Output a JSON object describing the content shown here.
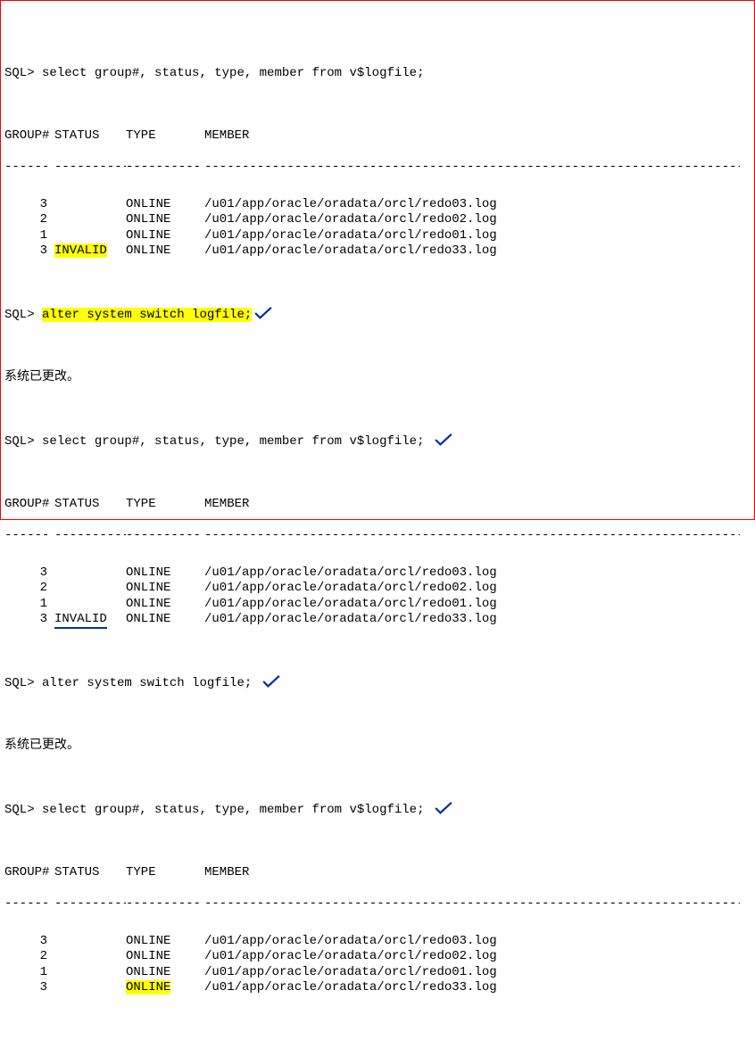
{
  "prompt": "SQL>",
  "cmd_select": "select group#, status, type, member from v$logfile;",
  "cmd_alter": "alter system switch logfile;",
  "msg_changed": "系统已更改。",
  "headers": {
    "group": "GROUP#",
    "status": "STATUS",
    "type": "TYPE",
    "member": "MEMBER"
  },
  "dashes": {
    "group": "------",
    "status": "----------",
    "type": "----------",
    "member": "--------------------------------------------------------------------------------"
  },
  "block1": {
    "rows": [
      {
        "group": "3",
        "status": "",
        "type": "ONLINE",
        "member": "/u01/app/oracle/oradata/orcl/redo03.log"
      },
      {
        "group": "2",
        "status": "",
        "type": "ONLINE",
        "member": "/u01/app/oracle/oradata/orcl/redo02.log"
      },
      {
        "group": "1",
        "status": "",
        "type": "ONLINE",
        "member": "/u01/app/oracle/oradata/orcl/redo01.log"
      },
      {
        "group": "3",
        "status": "INVALID",
        "type": "ONLINE",
        "member": "/u01/app/oracle/oradata/orcl/redo33.log",
        "status_hl": true
      }
    ]
  },
  "block2": {
    "rows": [
      {
        "group": "3",
        "status": "",
        "type": "ONLINE",
        "member": "/u01/app/oracle/oradata/orcl/redo03.log"
      },
      {
        "group": "2",
        "status": "",
        "type": "ONLINE",
        "member": "/u01/app/oracle/oradata/orcl/redo02.log"
      },
      {
        "group": "1",
        "status": "",
        "type": "ONLINE",
        "member": "/u01/app/oracle/oradata/orcl/redo01.log"
      },
      {
        "group": "3",
        "status": "INVALID",
        "type": "ONLINE",
        "member": "/u01/app/oracle/oradata/orcl/redo33.log",
        "status_ul": true
      }
    ]
  },
  "block3": {
    "rows": [
      {
        "group": "3",
        "status": "",
        "type": "ONLINE",
        "member": "/u01/app/oracle/oradata/orcl/redo03.log"
      },
      {
        "group": "2",
        "status": "",
        "type": "ONLINE",
        "member": "/u01/app/oracle/oradata/orcl/redo02.log"
      },
      {
        "group": "1",
        "status": "",
        "type": "ONLINE",
        "member": "/u01/app/oracle/oradata/orcl/redo01.log"
      },
      {
        "group": "3",
        "status": "",
        "type": "ONLINE",
        "member": "/u01/app/oracle/oradata/orcl/redo33.log",
        "type_hl": true
      }
    ]
  }
}
